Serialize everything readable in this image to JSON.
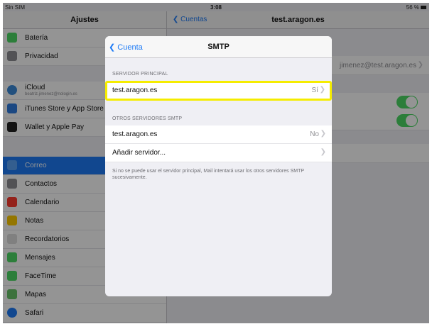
{
  "status_bar": {
    "carrier": "Sin SIM",
    "time": "3:08",
    "battery": "56 %"
  },
  "sidebar": {
    "title": "Ajustes",
    "items": [
      {
        "label": "Batería",
        "icon": "battery-icon",
        "color": "#4cd964"
      },
      {
        "label": "Privacidad",
        "icon": "hand-icon",
        "color": "#8e8e93"
      },
      {
        "label": "iCloud",
        "sub": "beatriz.jimenez@nologin.es",
        "icon": "cloud-icon",
        "color": "#3b8bd9"
      },
      {
        "label": "iTunes Store y App Store",
        "icon": "app-store-icon",
        "color": "#2f7de1"
      },
      {
        "label": "Wallet y Apple Pay",
        "icon": "wallet-icon",
        "color": "#222222"
      },
      {
        "label": "Correo",
        "icon": "mail-icon",
        "color": "#1e7bf6"
      },
      {
        "label": "Contactos",
        "icon": "contacts-icon",
        "color": "#8e8e93"
      },
      {
        "label": "Calendario",
        "icon": "calendar-icon",
        "color": "#ff3b30"
      },
      {
        "label": "Notas",
        "icon": "notes-icon",
        "color": "#ffcc00"
      },
      {
        "label": "Recordatorios",
        "icon": "reminders-icon",
        "color": "#dddddd"
      },
      {
        "label": "Mensajes",
        "icon": "messages-icon",
        "color": "#4cd964"
      },
      {
        "label": "FaceTime",
        "icon": "facetime-icon",
        "color": "#4cd964"
      },
      {
        "label": "Mapas",
        "icon": "maps-icon",
        "color": "#6ac46a"
      },
      {
        "label": "Safari",
        "icon": "safari-icon",
        "color": "#1e7bf6"
      }
    ]
  },
  "detail": {
    "back_label": "Cuentas",
    "title": "test.aragon.es",
    "account_email": "jimenez@test.aragon.es"
  },
  "modal": {
    "back_label": "Cuenta",
    "title": "SMTP",
    "primary_header": "SERVIDOR PRINCIPAL",
    "primary_server": {
      "label": "test.aragon.es",
      "value": "Sí"
    },
    "other_header": "OTROS SERVIDORES SMTP",
    "other_servers": [
      {
        "label": "test.aragon.es",
        "value": "No"
      },
      {
        "label": "Añadir servidor...",
        "value": ""
      }
    ],
    "footer": "Si no se puede usar el servidor principal, Mail intentará usar los otros servidores SMTP sucesivamente."
  },
  "colors": {
    "accent": "#1e7bf6",
    "highlight": "#f5ec00",
    "toggle_on": "#4cd964"
  }
}
